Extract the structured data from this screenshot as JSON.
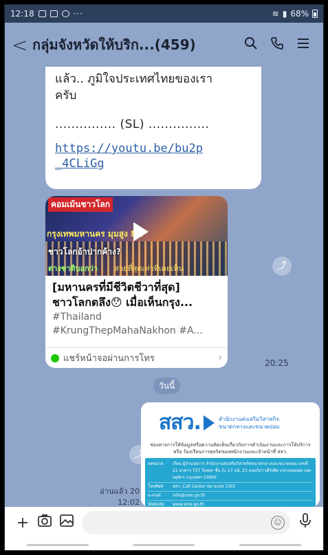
{
  "status_bar": {
    "time": "12:18",
    "icons": [
      "gallery-icon",
      "app-icon",
      "chrome-icon"
    ],
    "more": "···",
    "battery": "68%"
  },
  "header": {
    "back_icon": "back-arrow-icon",
    "title": "กลุ่มจังหวัดให้บริก...(459)",
    "actions": [
      "search-icon",
      "call-icon",
      "menu-icon"
    ]
  },
  "messages": {
    "text_bubble": {
      "line1": "แล้ว.. ภูมิใจประเทศไทยของเรา",
      "line2": "ครับ",
      "signature": "............... (SL) ...............",
      "link_line1": "https://youtu.be/bu2p",
      "link_line2": "_4CLiGg"
    },
    "video_card": {
      "thumb_caption1": "คอมเม้นชาวโลก",
      "thumb_caption2": "กรุงเทพมหานคร มุมสูง 8K",
      "thumb_caption3": "ชาวโลกอ้าปากค้าง?",
      "thumb_caption4": "ต่างชาติบอกว่า",
      "thumb_caption5": "สวยที่สุดเท่าที่เคยเห็น",
      "title_line1": "[มหานครที่มีชีวิตชีวาที่สุด]",
      "title_line2": "ชาวโลกตลึง😯 เมื่อเห็นกรุง...",
      "tag_line1": "#Thailand",
      "tag_line2": "#KrungThepMahaNakhon #A...",
      "footer_label": "แชร์หน้าจอผ่านการโทร",
      "time": "20:25"
    },
    "date_divider": "วันนี้",
    "image_message": {
      "logo_mark": "สสว.",
      "logo_line1": "สำนักงานส่งเสริมวิสาหกิจ",
      "logo_line2": "ขนาดกลางและขนาดย่อม",
      "subtitle_line1": "ช่องทางการให้ข้อมูลหรือความคิดเห็นเกี่ยวกับการดำเนินงานและการให้บริการ",
      "subtitle_line2": "หรือ ร้องเรียนการทุจริตของพนักงานและเจ้าหน้าที่ สสว.",
      "rows": [
        {
          "key": "จดหมาย",
          "value": "เรียน ผู้อำนวยการ สำนักงานส่งเสริมวิสาหกิจขนาดกลางและขนาดย่อม เลขที่ 21 อาคาร TST Tower ชั้น G, 17-18, 23 ถนนวิภาวดีรังสิต แขวงจอมพล เขตจตุจักร กรุงเทพฯ 10900"
        },
        {
          "key": "โทรศัพท์",
          "value": "สสว. Call Center หมายเลข 1301"
        },
        {
          "key": "e-mail",
          "value": "info@sme.go.th"
        },
        {
          "key": "Website",
          "value": "www.sme.go.th"
        }
      ],
      "read_label": "อ่านแล้ว 20",
      "time": "12:02"
    }
  },
  "input_bar": {
    "add_icon": "plus-icon",
    "camera_icon": "camera-icon",
    "image_icon": "image-icon",
    "placeholder": "",
    "emoji_icon": "emoji-icon",
    "mic_icon": "mic-icon"
  },
  "colors": {
    "chat_bg": "#8fa5c9",
    "status_bar": "#2e3f5c",
    "link": "#2d5fa8",
    "brand_blue": "#1a74c9",
    "line_green": "#1ec800"
  }
}
